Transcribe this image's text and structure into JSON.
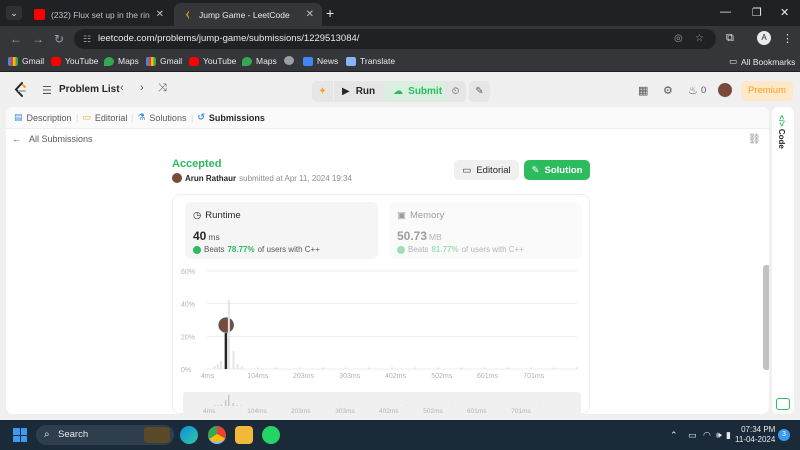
{
  "browser": {
    "tabs": [
      {
        "title": "(232) Flux set up in the ring, f",
        "icon": "youtube-icon",
        "active": false
      },
      {
        "title": "Jump Game - LeetCode",
        "icon": "leetcode-icon",
        "active": true
      }
    ],
    "url": "leetcode.com/problems/jump-game/submissions/1229513084/",
    "profile_initial": "A",
    "bookmarks": [
      {
        "label": "Gmail",
        "icon": "gmail-icon"
      },
      {
        "label": "YouTube",
        "icon": "youtube-icon"
      },
      {
        "label": "Maps",
        "icon": "maps-icon"
      },
      {
        "label": "Gmail",
        "icon": "gmail-icon"
      },
      {
        "label": "YouTube",
        "icon": "youtube-icon"
      },
      {
        "label": "Maps",
        "icon": "maps-icon"
      },
      {
        "label": "",
        "icon": "globe-icon"
      },
      {
        "label": "News",
        "icon": "news-icon"
      },
      {
        "label": "Translate",
        "icon": "translate-icon"
      }
    ],
    "all_bookmarks": "All Bookmarks"
  },
  "lc_header": {
    "problem_list": "Problem List",
    "run": "Run",
    "submit": "Submit",
    "streak": "0",
    "premium": "Premium"
  },
  "subtabs": {
    "description": "Description",
    "editorial": "Editorial",
    "solutions": "Solutions",
    "submissions": "Submissions"
  },
  "submission": {
    "back_label": "All Submissions",
    "status": "Accepted",
    "user": "Arun Rathaur",
    "submitted_text": "submitted at Apr 11, 2024 19:34",
    "editorial_btn": "Editorial",
    "solution_btn": "Solution",
    "runtime": {
      "label": "Runtime",
      "value": "40",
      "unit": "ms",
      "beats_prefix": "Beats",
      "beats_pct": "78.77%",
      "beats_suffix": "of users with C++"
    },
    "memory": {
      "label": "Memory",
      "value": "50.73",
      "unit": "MB",
      "beats_prefix": "Beats",
      "beats_pct": "81.77%",
      "beats_suffix": "of users with C++"
    }
  },
  "chart_data": {
    "type": "bar",
    "categories": [
      "4ms",
      "104ms",
      "203ms",
      "303ms",
      "402ms",
      "502ms",
      "601ms",
      "701ms"
    ],
    "yticks": [
      "0%",
      "20%",
      "40%",
      "60%"
    ],
    "ylim": [
      0,
      60
    ],
    "bars": [
      {
        "x_ms": 16,
        "value": 2,
        "highlight": false
      },
      {
        "x_ms": 23,
        "value": 3,
        "highlight": false
      },
      {
        "x_ms": 30,
        "value": 5,
        "highlight": false
      },
      {
        "x_ms": 40,
        "value": 22,
        "highlight": true
      },
      {
        "x_ms": 47,
        "value": 42,
        "highlight": false
      },
      {
        "x_ms": 57,
        "value": 11,
        "highlight": false
      },
      {
        "x_ms": 66,
        "value": 3,
        "highlight": false
      },
      {
        "x_ms": 75,
        "value": 1.5,
        "highlight": false
      },
      {
        "x_ms": 110,
        "value": 1,
        "highlight": false
      },
      {
        "x_ms": 150,
        "value": 1,
        "highlight": false
      },
      {
        "x_ms": 200,
        "value": 1,
        "highlight": false
      },
      {
        "x_ms": 250,
        "value": 1,
        "highlight": false
      },
      {
        "x_ms": 300,
        "value": 1,
        "highlight": false
      },
      {
        "x_ms": 350,
        "value": 1,
        "highlight": false
      },
      {
        "x_ms": 400,
        "value": 1,
        "highlight": false
      },
      {
        "x_ms": 450,
        "value": 1,
        "highlight": false
      },
      {
        "x_ms": 500,
        "value": 1,
        "highlight": false
      },
      {
        "x_ms": 550,
        "value": 1,
        "highlight": false
      },
      {
        "x_ms": 600,
        "value": 1,
        "highlight": false
      },
      {
        "x_ms": 650,
        "value": 1,
        "highlight": false
      },
      {
        "x_ms": 700,
        "value": 1,
        "highlight": false
      },
      {
        "x_ms": 750,
        "value": 1,
        "highlight": false
      },
      {
        "x_ms": 800,
        "value": 1,
        "highlight": false
      }
    ],
    "xrange_ms": [
      4,
      800
    ],
    "grid": true
  },
  "rail": {
    "code_label": "Code",
    "code_icon": "</>"
  },
  "taskbar": {
    "search": "Search",
    "time": "07:34 PM",
    "date": "11-04-2024",
    "notifications": "3"
  },
  "colors": {
    "accent_green": "#2cbb5d",
    "accent_orange": "#ffa116"
  }
}
